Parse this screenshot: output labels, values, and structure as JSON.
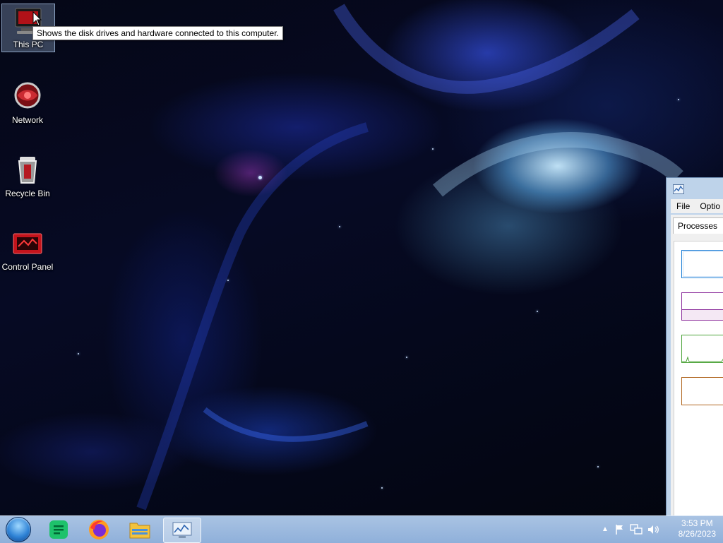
{
  "desktop": {
    "icons": [
      {
        "label": "This PC",
        "icon": "computer-icon"
      },
      {
        "label": "Network",
        "icon": "network-icon"
      },
      {
        "label": "Recycle Bin",
        "icon": "recycle-bin-icon"
      },
      {
        "label": "Control Panel",
        "icon": "control-panel-icon"
      }
    ],
    "tooltip": "Shows the disk drives and hardware connected to this computer."
  },
  "task_manager": {
    "menu": [
      "File",
      "Optio"
    ],
    "tab": "Processes",
    "graph_colors": {
      "cpu": "#1c7ed6",
      "memory": "#8b2c9b",
      "disk": "#4da33a",
      "network": "#b0651e"
    }
  },
  "taskbar": {
    "pinned": [
      {
        "icon": "start-orb-icon"
      },
      {
        "icon": "green-notes-app-icon"
      },
      {
        "icon": "firefox-icon"
      },
      {
        "icon": "file-explorer-icon"
      },
      {
        "icon": "task-manager-icon"
      }
    ],
    "tray_icons": [
      "show-hidden-icons-chevron",
      "action-center-flag-icon",
      "network-icon",
      "volume-icon"
    ],
    "clock": {
      "time": "3:53 PM",
      "date": "8/26/2023"
    }
  },
  "colors": {
    "taskbar": "#9fbbe0",
    "selection": "#8aa0c0"
  }
}
